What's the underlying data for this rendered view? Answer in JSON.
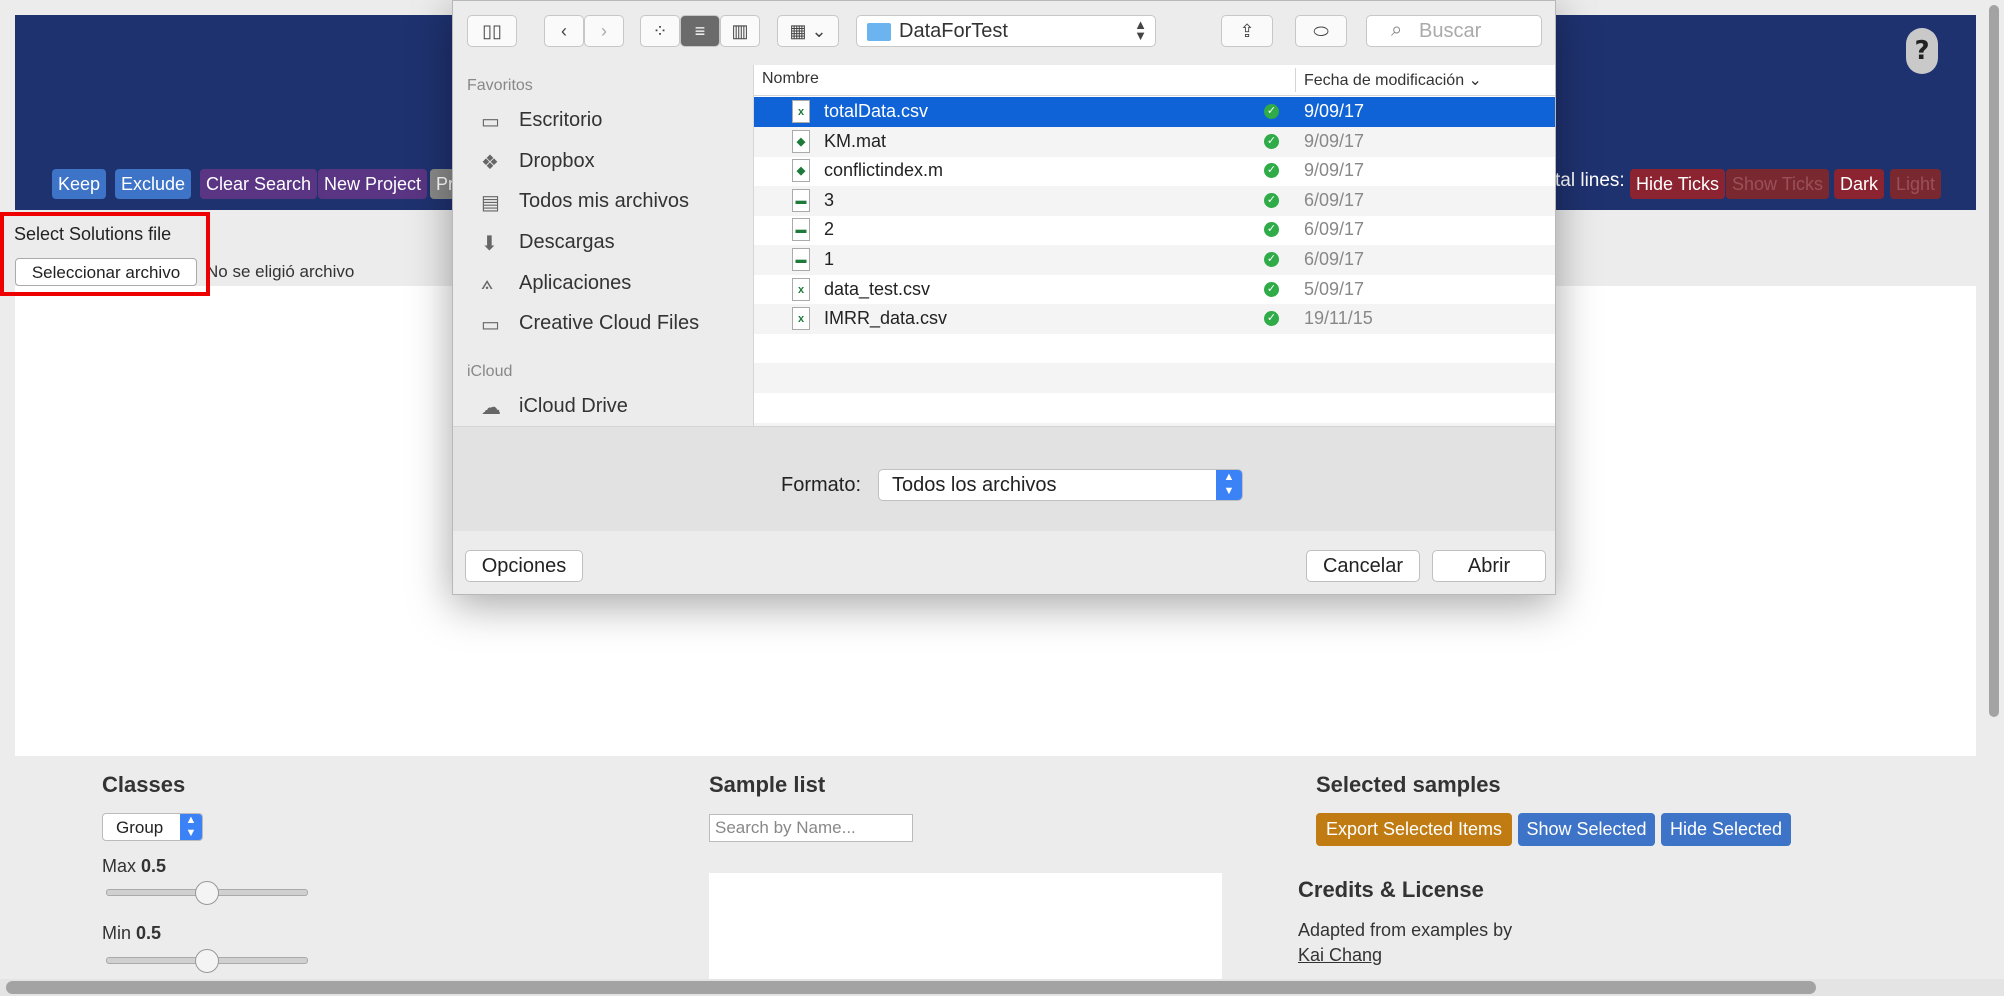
{
  "header": {
    "help_label": "?",
    "buttons": {
      "keep": "Keep",
      "exclude": "Exclude",
      "clear_search": "Clear Search",
      "new_project": "New Project",
      "partial": "Pr"
    },
    "total_lines_label": "tal lines:",
    "hide_ticks": "Hide Ticks",
    "show_ticks": "Show Ticks",
    "dark": "Dark",
    "light": "Light"
  },
  "upload": {
    "label": "Select Solutions file",
    "button": "Seleccionar archivo",
    "status": "No se eligió archivo"
  },
  "classes": {
    "title": "Classes",
    "select_value": "Group",
    "max_label": "Max",
    "max_value": "0.5",
    "min_label": "Min",
    "min_value": "0.5"
  },
  "sample_list": {
    "title": "Sample list",
    "search_placeholder": "Search by Name..."
  },
  "selected_samples": {
    "title": "Selected samples",
    "export": "Export Selected Items",
    "show": "Show Selected",
    "hide": "Hide Selected"
  },
  "credits": {
    "title": "Credits & License",
    "text": "Adapted from examples by",
    "link": "Kai Chang"
  },
  "dialog": {
    "path": "DataForTest",
    "search_placeholder": "Buscar",
    "sidebar": {
      "favorites_header": "Favoritos",
      "favorites": [
        {
          "label": "Escritorio",
          "icon": "desktop-icon"
        },
        {
          "label": "Dropbox",
          "icon": "dropbox-icon"
        },
        {
          "label": "Todos mis archivos",
          "icon": "all-files-icon"
        },
        {
          "label": "Descargas",
          "icon": "downloads-icon"
        },
        {
          "label": "Aplicaciones",
          "icon": "applications-icon"
        },
        {
          "label": "Creative Cloud Files",
          "icon": "folder-icon"
        }
      ],
      "icloud_header": "iCloud",
      "icloud": [
        {
          "label": "iCloud Drive",
          "icon": "cloud-icon"
        }
      ]
    },
    "columns": {
      "name": "Nombre",
      "date": "Fecha de modificación"
    },
    "files": [
      {
        "name": "totalData.csv",
        "date": "9/09/17",
        "selected": true,
        "dim": false,
        "icon": "csv-icon"
      },
      {
        "name": "KM.mat",
        "date": "9/09/17",
        "selected": false,
        "dim": true,
        "icon": "matlab-icon"
      },
      {
        "name": "conflictindex.m",
        "date": "9/09/17",
        "selected": false,
        "dim": true,
        "icon": "matlab-icon"
      },
      {
        "name": "3",
        "date": "6/09/17",
        "selected": false,
        "dim": true,
        "icon": "image-icon"
      },
      {
        "name": "2",
        "date": "6/09/17",
        "selected": false,
        "dim": true,
        "icon": "image-icon"
      },
      {
        "name": "1",
        "date": "6/09/17",
        "selected": false,
        "dim": true,
        "icon": "image-icon"
      },
      {
        "name": "data_test.csv",
        "date": "5/09/17",
        "selected": false,
        "dim": true,
        "icon": "csv-icon"
      },
      {
        "name": "IMRR_data.csv",
        "date": "19/11/15",
        "selected": false,
        "dim": true,
        "icon": "csv-icon"
      }
    ],
    "format_label": "Formato:",
    "format_value": "Todos los archivos",
    "options": "Opciones",
    "cancel": "Cancelar",
    "open": "Abrir"
  }
}
